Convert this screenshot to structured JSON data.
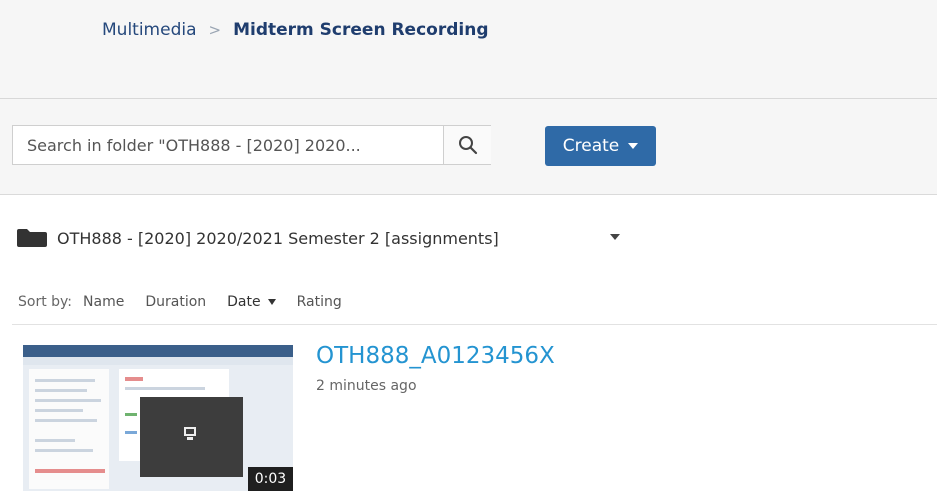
{
  "breadcrumb": {
    "parent": "Multimedia",
    "separator": ">",
    "current": "Midterm Screen Recording"
  },
  "toolbar": {
    "search_placeholder": "Search in folder \"OTH888 - [2020] 2020...",
    "search_icon": "search-icon",
    "create_label": "Create"
  },
  "folder": {
    "icon": "folder-icon",
    "name": "OTH888 - [2020] 2020/2021 Semester 2 [assignments]"
  },
  "sort": {
    "label": "Sort by:",
    "options": [
      "Name",
      "Duration",
      "Date",
      "Rating"
    ],
    "active": "Date"
  },
  "videos": [
    {
      "title": "OTH888_A0123456X",
      "time": "2 minutes ago",
      "duration": "0:03"
    }
  ],
  "colors": {
    "accent": "#2f6aa7",
    "link": "#2494d1",
    "breadcrumb": "#25487c"
  }
}
